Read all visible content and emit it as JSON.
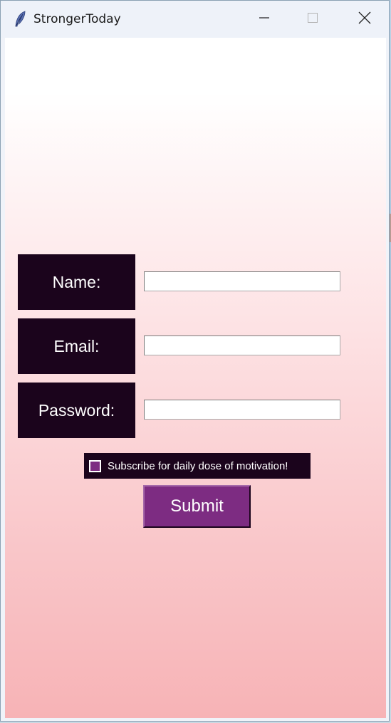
{
  "window": {
    "title": "StrongerToday",
    "app_icon": "feather-icon",
    "controls": {
      "minimize_icon": "minimize-icon",
      "maximize_icon": "maximize-icon",
      "close_icon": "close-icon"
    }
  },
  "form": {
    "name_label": "Name:",
    "email_label": "Email:",
    "password_label": "Password:",
    "name_value": "",
    "email_value": "",
    "password_value": "",
    "subscribe_label": "Subscribe for daily dose of motivation!",
    "subscribe_checked": false,
    "submit_label": "Submit"
  },
  "colors": {
    "label_bg": "#1b041c",
    "accent_purple": "#7d2c82",
    "gradient_top": "#ffffff",
    "gradient_bottom": "#f7b3b6"
  }
}
